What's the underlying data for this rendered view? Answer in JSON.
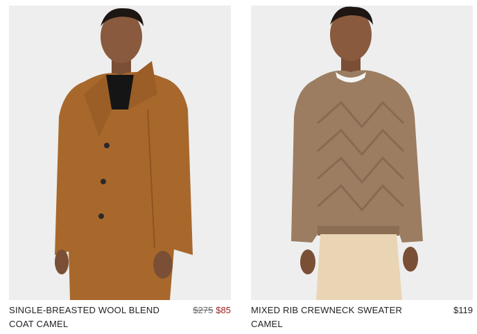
{
  "products": [
    {
      "name": "SINGLE-BREASTED WOOL BLEND COAT CAMEL",
      "original_price": "$275",
      "sale_price": "$85",
      "image_icon": "coat-product-image",
      "accent_color": "#9b1c1c"
    },
    {
      "name": "MIXED RIB CREWNECK SWEATER CAMEL",
      "price": "$119",
      "image_icon": "sweater-product-image"
    }
  ]
}
